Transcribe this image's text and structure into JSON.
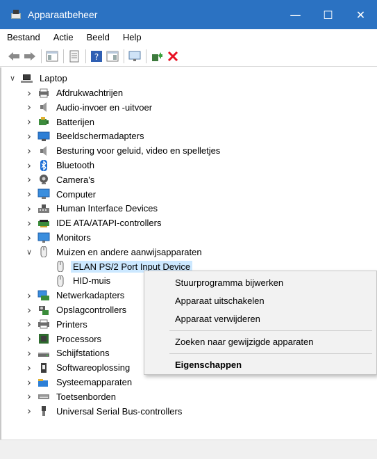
{
  "window": {
    "title": "Apparaatbeheer",
    "controls": {
      "minimize": "—",
      "maximize": "☐",
      "close": "✕"
    }
  },
  "menu": [
    {
      "label": "Bestand"
    },
    {
      "label": "Actie"
    },
    {
      "label": "Beeld"
    },
    {
      "label": "Help"
    }
  ],
  "toolbar": [
    {
      "icon": "back-arrow-icon"
    },
    {
      "icon": "forward-arrow-icon"
    },
    {
      "icon": "properties-pane-icon"
    },
    {
      "icon": "document-icon"
    },
    {
      "icon": "help-icon"
    },
    {
      "icon": "view-pane-icon"
    },
    {
      "icon": "monitor-scan-icon"
    },
    {
      "icon": "update-driver-icon"
    },
    {
      "icon": "remove-device-icon"
    }
  ],
  "tree": {
    "root": "Laptop",
    "categories": [
      {
        "label": "Afdrukwachtrijen",
        "icon": "printer-queue-icon"
      },
      {
        "label": "Audio-invoer en -uitvoer",
        "icon": "speaker-icon"
      },
      {
        "label": "Batterijen",
        "icon": "battery-icon"
      },
      {
        "label": "Beeldschermadapters",
        "icon": "display-adapter-icon"
      },
      {
        "label": "Besturing voor geluid, video en spelletjes",
        "icon": "speaker-icon"
      },
      {
        "label": "Bluetooth",
        "icon": "bluetooth-icon"
      },
      {
        "label": "Camera's",
        "icon": "camera-icon"
      },
      {
        "label": "Computer",
        "icon": "computer-icon"
      },
      {
        "label": "Human Interface Devices",
        "icon": "hid-icon"
      },
      {
        "label": "IDE ATA/ATAPI-controllers",
        "icon": "ide-controller-icon"
      },
      {
        "label": "Monitors",
        "icon": "monitor-icon"
      },
      {
        "label": "Muizen en andere aanwijsapparaten",
        "icon": "mouse-icon",
        "expanded": true
      },
      {
        "label": "ELAN PS/2 Port Input Device",
        "icon": "mouse-icon",
        "child": true,
        "selected": true
      },
      {
        "label": "HID-muis",
        "icon": "mouse-icon",
        "child": true
      },
      {
        "label": "Netwerkadapters",
        "icon": "network-adapter-icon"
      },
      {
        "label": "Opslagcontrollers",
        "icon": "storage-controller-icon"
      },
      {
        "label": "Printers",
        "icon": "printer-icon"
      },
      {
        "label": "Processors",
        "icon": "processor-icon"
      },
      {
        "label": "Schijfstations",
        "icon": "disk-drive-icon"
      },
      {
        "label": "Softwareoplossing",
        "icon": "software-component-icon"
      },
      {
        "label": "Systeemapparaten",
        "icon": "system-devices-icon"
      },
      {
        "label": "Toetsenborden",
        "icon": "keyboard-icon"
      },
      {
        "label": "Universal Serial Bus-controllers",
        "icon": "usb-icon"
      }
    ]
  },
  "context_menu": [
    {
      "label": "Stuurprogramma bijwerken"
    },
    {
      "label": "Apparaat uitschakelen"
    },
    {
      "label": "Apparaat verwijderen"
    },
    {
      "label": "Zoeken naar gewijzigde apparaten"
    },
    {
      "label": "Eigenschappen",
      "bold": true
    }
  ],
  "colors": {
    "titlebar": "#2b72c2",
    "selection": "#cce8ff",
    "context_menu_bg": "#f2f2f2",
    "remove_red": "#e81123"
  }
}
